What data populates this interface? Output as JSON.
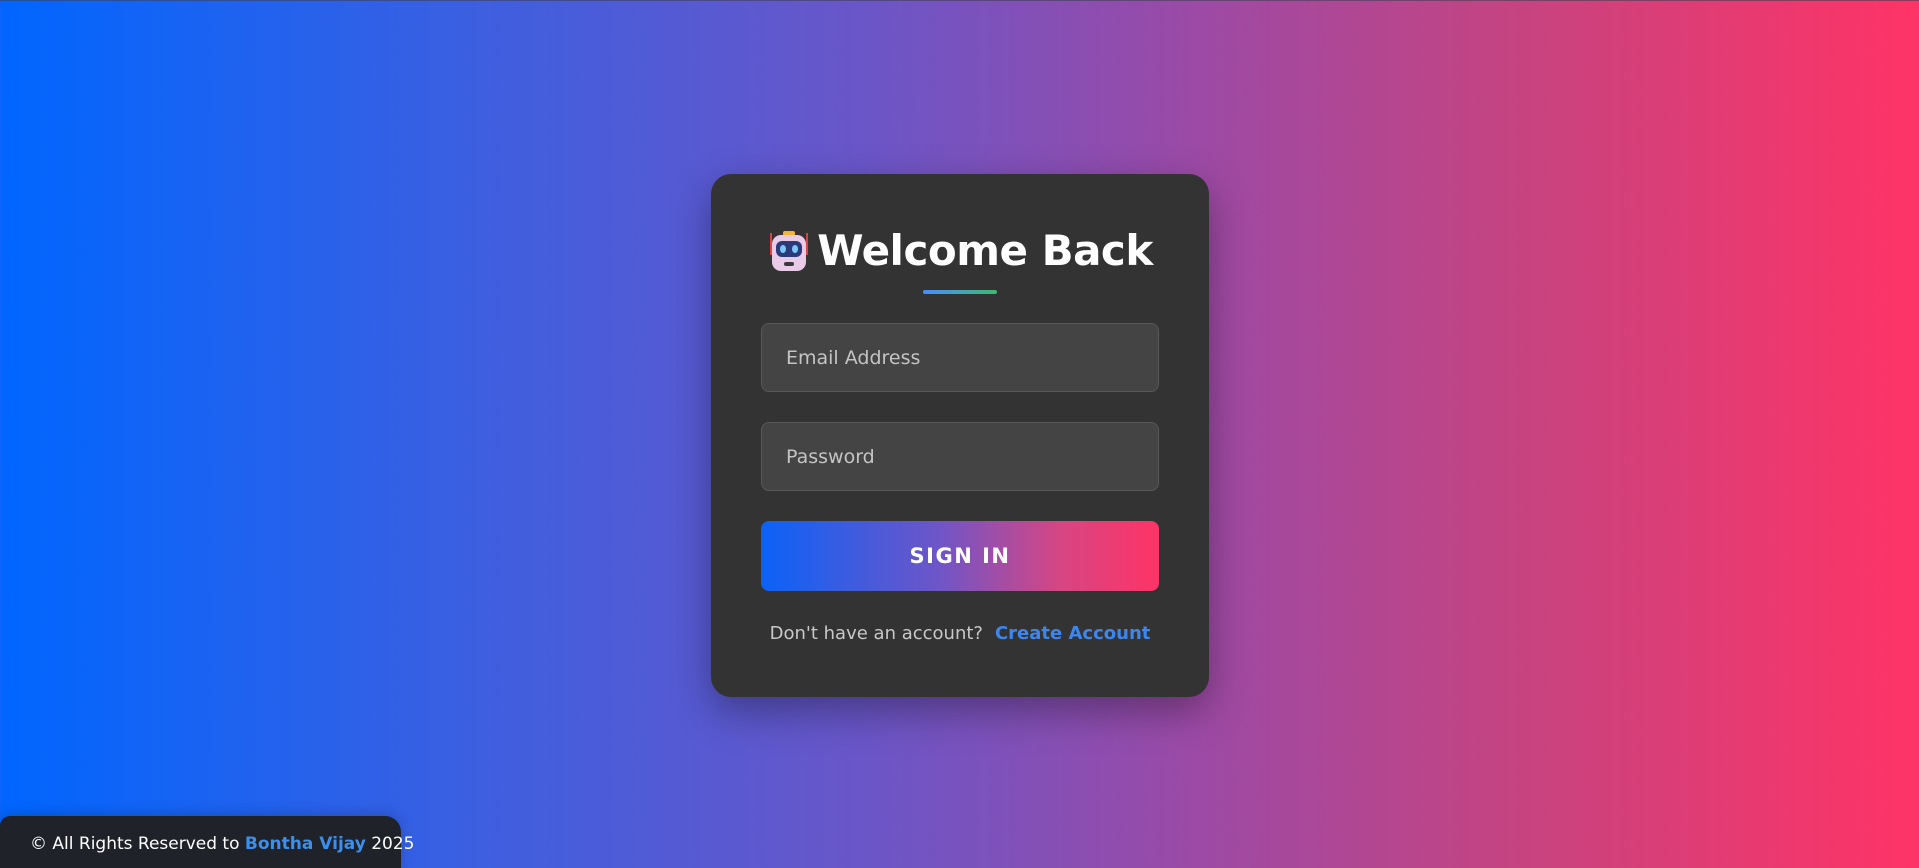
{
  "login_card": {
    "title": "Welcome Back",
    "title_icon": "robot-icon",
    "email_placeholder": "Email Address",
    "password_placeholder": "Password",
    "signin_label": "SIGN IN",
    "signup_prompt": "Don't have an account?",
    "signup_link": "Create Account"
  },
  "footer": {
    "prefix": "© All Rights Reserved to",
    "name": "Bontha Vijay",
    "year": "2025"
  },
  "colors": {
    "background_start": "#0066ff",
    "background_end": "#ff3366",
    "card": "#333333",
    "link": "#3c86f0",
    "footer": "#1f2228"
  }
}
